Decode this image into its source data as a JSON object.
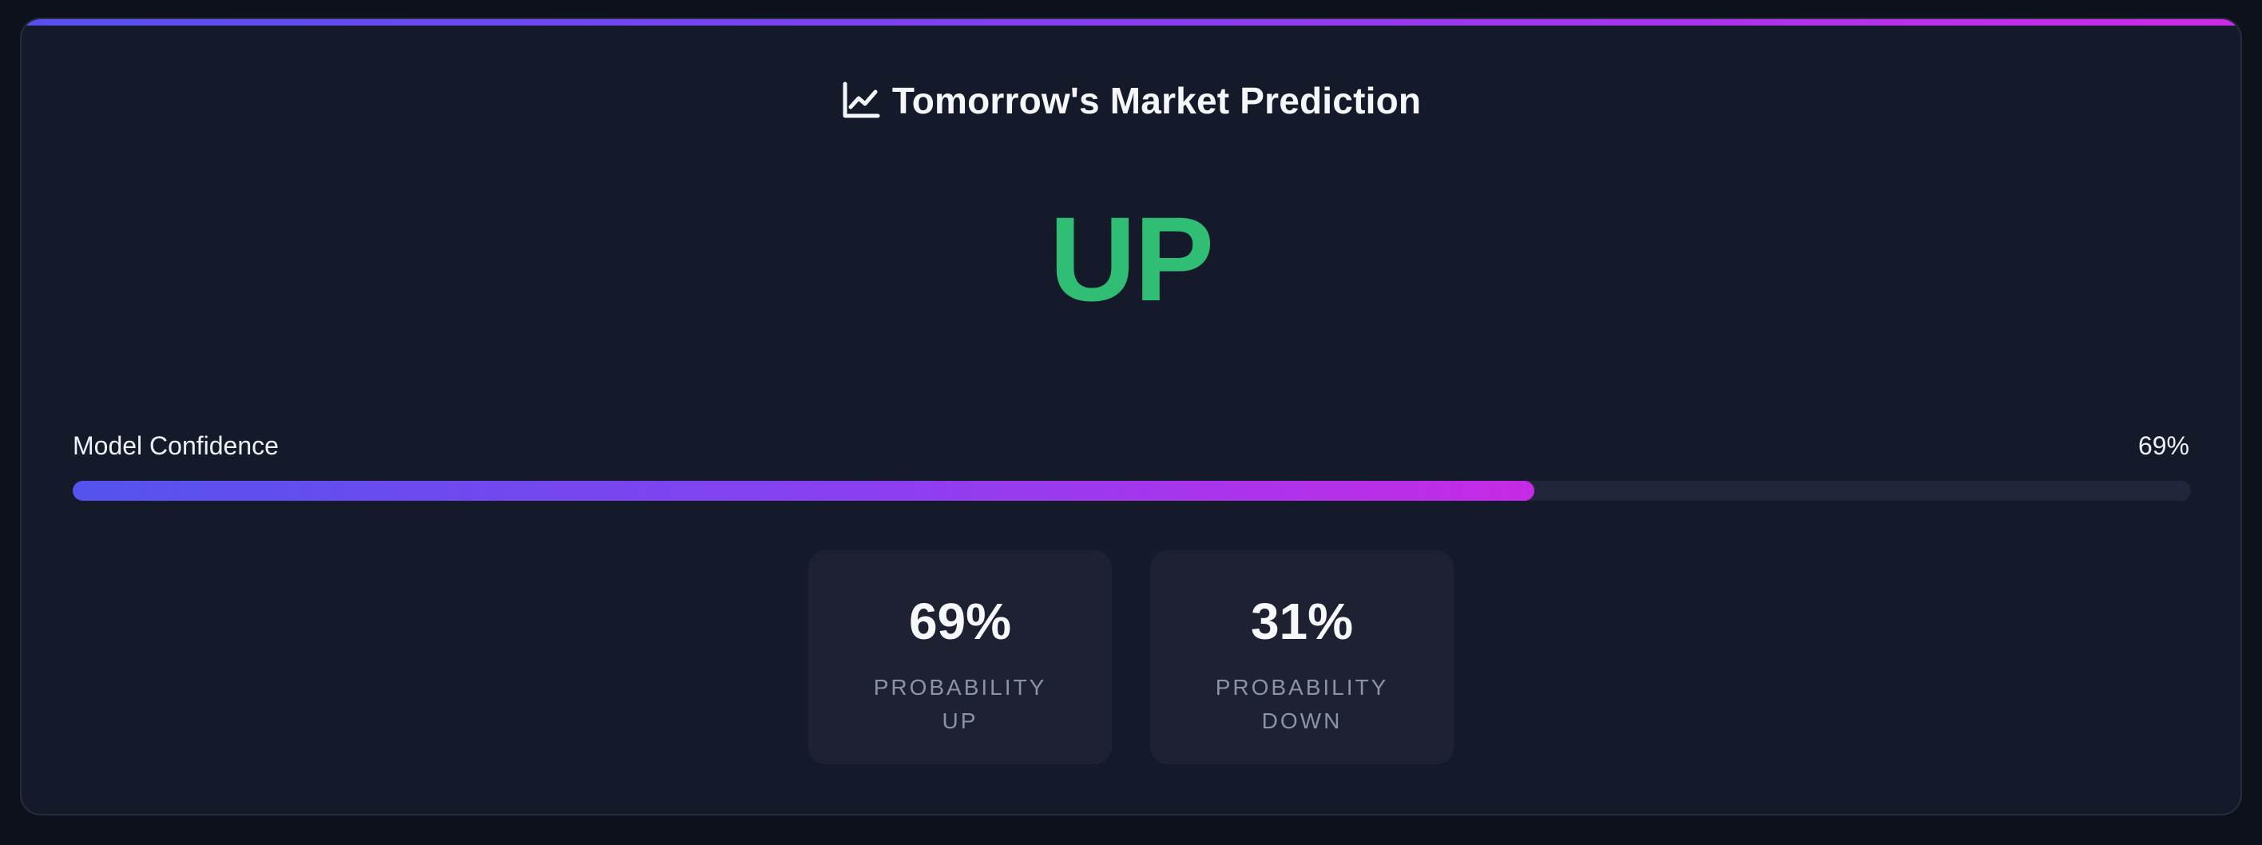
{
  "header": {
    "title": "Tomorrow's Market Prediction",
    "icon": "trend-chart-icon"
  },
  "prediction": {
    "direction": "UP",
    "color": "#2fbe74"
  },
  "confidence": {
    "label": "Model Confidence",
    "value_text": "69%",
    "value": 0.69
  },
  "stats": [
    {
      "value": "69%",
      "label": "PROBABILITY UP"
    },
    {
      "value": "31%",
      "label": "PROBABILITY DOWN"
    }
  ],
  "colors": {
    "background": "#0d111c",
    "card": "#151a2b",
    "accent_start": "#5650ef",
    "accent_end": "#cd2ae6",
    "muted_text": "#8b93a8"
  }
}
